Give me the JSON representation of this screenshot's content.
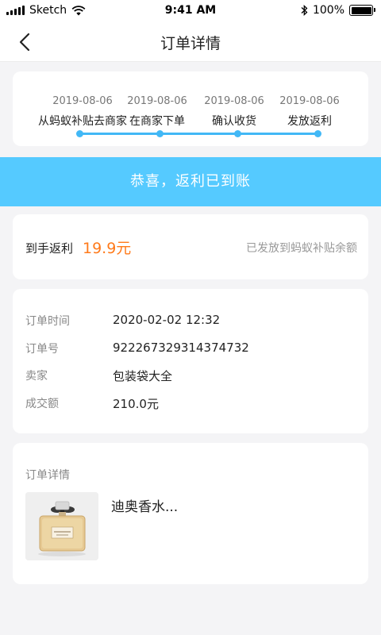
{
  "status": {
    "carrier": "Sketch",
    "time": "9:41 AM",
    "battery": "100%"
  },
  "nav": {
    "title": "订单详情"
  },
  "progress": {
    "steps": [
      {
        "date": "2019-08-06",
        "label": "从蚂蚁补贴去商家"
      },
      {
        "date": "2019-08-06",
        "label": "在商家下单"
      },
      {
        "date": "2019-08-06",
        "label": "确认收货"
      },
      {
        "date": "2019-08-06",
        "label": "发放返利"
      }
    ],
    "color": "#42b8f6"
  },
  "banner": {
    "text": "恭喜，返利已到账",
    "color": "#55caff"
  },
  "rebate": {
    "label": "到手返利",
    "value": "19.9元",
    "note": "已发放到蚂蚁补贴余额",
    "value_color": "#ff7a1a"
  },
  "order_info": {
    "rows": [
      {
        "key": "订单时间",
        "value": "2020-02-02 12:32"
      },
      {
        "key": "订单号",
        "value": "922267329314374732"
      },
      {
        "key": "卖家",
        "value": "包装袋大全"
      },
      {
        "key": "成交额",
        "value": "210.0元"
      }
    ]
  },
  "order_detail": {
    "title": "订单详情",
    "product_name": "迪奥香水...",
    "product_image_icon": "perfume-bottle-image"
  }
}
